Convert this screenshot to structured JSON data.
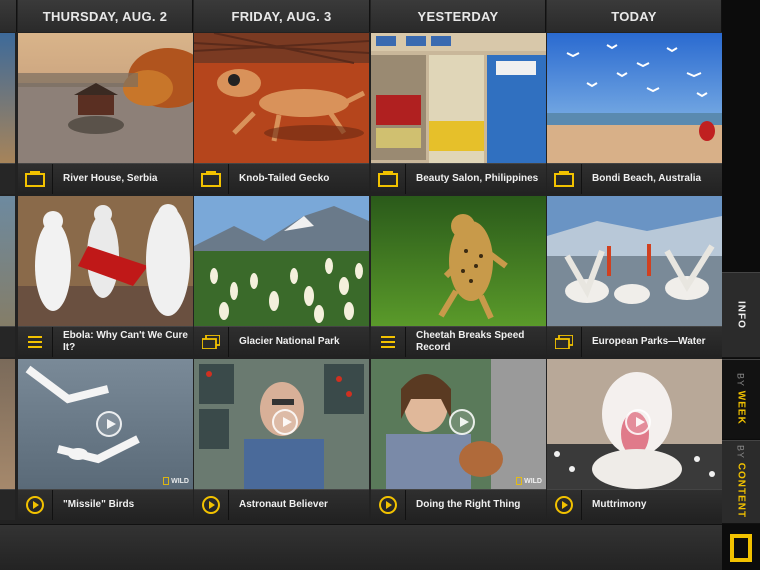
{
  "columns": [
    {
      "header": "THURSDAY, AUG. 2"
    },
    {
      "header": "FRIDAY, AUG. 3"
    },
    {
      "header": "YESTERDAY"
    },
    {
      "header": "TODAY"
    }
  ],
  "rows": [
    [
      {
        "title": "River House, Serbia",
        "type": "photo"
      },
      {
        "title": "Knob-Tailed Gecko",
        "type": "photo"
      },
      {
        "title": "Beauty Salon, Philippines",
        "type": "photo"
      },
      {
        "title": "Bondi Beach, Australia",
        "type": "photo"
      }
    ],
    [
      {
        "title": "Ebola: Why Can't We Cure It?",
        "type": "article"
      },
      {
        "title": "Glacier National Park",
        "type": "gallery"
      },
      {
        "title": "Cheetah Breaks Speed Record",
        "type": "article"
      },
      {
        "title": "European Parks—Water",
        "type": "gallery"
      }
    ],
    [
      {
        "title": "\"Missile\" Birds",
        "type": "video",
        "badge": "WILD"
      },
      {
        "title": "Astronaut Believer",
        "type": "video",
        "badge": ""
      },
      {
        "title": "Doing the Right Thing",
        "type": "video",
        "badge": "WILD"
      },
      {
        "title": "Muttrimony",
        "type": "video",
        "badge": ""
      }
    ]
  ],
  "sidebar": {
    "tabs": [
      {
        "label": "INFO"
      },
      {
        "prefix": "BY",
        "label": "WEEK"
      },
      {
        "prefix": "BY",
        "label": "CONTENT"
      }
    ]
  },
  "colors": {
    "accent": "#f2c200",
    "background": "#222222",
    "caption": "#2a2a2a"
  }
}
